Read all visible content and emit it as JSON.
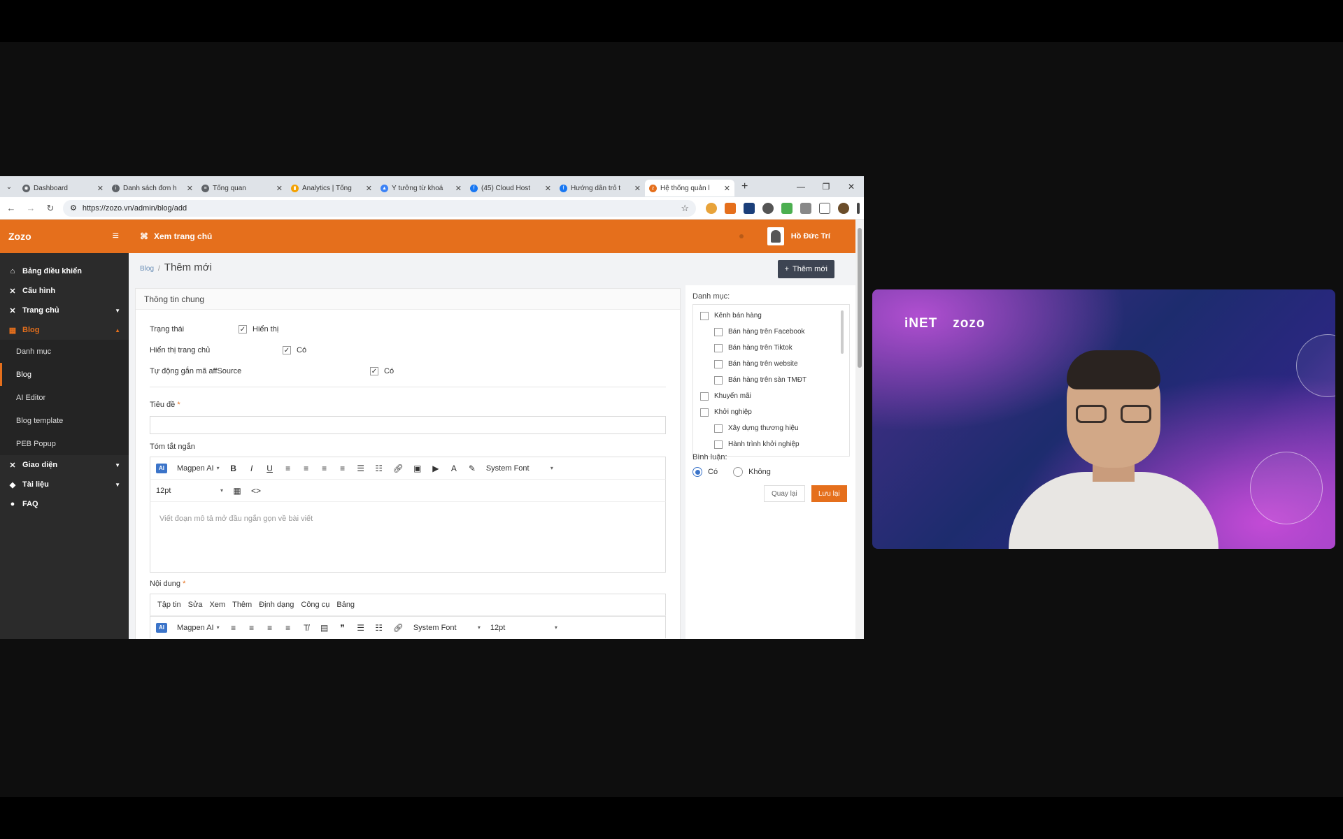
{
  "browser": {
    "tabs": [
      {
        "label": "Dashboard",
        "active": false
      },
      {
        "label": "Danh sách đơn h",
        "active": false
      },
      {
        "label": "Tổng quan",
        "active": false
      },
      {
        "label": "Analytics | Tổng",
        "active": false
      },
      {
        "label": "Ý tưởng từ khoá",
        "active": false
      },
      {
        "label": "(45) Cloud Host",
        "active": false
      },
      {
        "label": "Hướng dẫn trỏ t",
        "active": false
      },
      {
        "label": "Hệ thống quản l",
        "active": true
      }
    ],
    "url": "https://zozo.vn/admin/blog/add"
  },
  "app": {
    "logo": "Zozo",
    "top_nav_link": "Xem trang chủ",
    "user_name": "Hồ Đức Trí",
    "sidebar": {
      "items": [
        {
          "label": "Bảng điều khiển",
          "icon": "home-icon"
        },
        {
          "label": "Cấu hình",
          "icon": "tools-icon"
        },
        {
          "label": "Trang chủ",
          "icon": "tools-icon"
        },
        {
          "label": "Blog",
          "icon": "blog-icon"
        },
        {
          "label": "Giao diện",
          "icon": "tools-icon"
        },
        {
          "label": "Tài liệu",
          "icon": "tag-icon"
        },
        {
          "label": "FAQ",
          "icon": "user-icon"
        }
      ],
      "blog_subitems": [
        "Danh mục",
        "Blog",
        "AI Editor",
        "Blog template",
        "PEB Popup"
      ]
    },
    "breadcrumb": {
      "parent": "Blog",
      "separator": "/",
      "current": "Thêm mới"
    },
    "add_button": "Thêm mới",
    "panel_title": "Thông tin chung",
    "form": {
      "status_label": "Trạng thái",
      "status_value": "Hiển thị",
      "home_label": "Hiển thị trang chủ",
      "home_value": "Có",
      "aff_label": "Tự động gắn mã affSource",
      "aff_value": "Có",
      "title_label": "Tiêu đề",
      "title_value": "",
      "summary_label": "Tóm tắt ngắn",
      "summary_placeholder": "Viết đoạn mô tả mở đầu ngắn gọn về bài viết",
      "content_label": "Nội dung",
      "required_mark": "*"
    },
    "editor": {
      "ai_label": "AI",
      "magpen": "Magpen AI",
      "font": "System Font",
      "size": "12pt",
      "menu": [
        "Tập tin",
        "Sửa",
        "Xem",
        "Thêm",
        "Định dạng",
        "Công cụ",
        "Bảng"
      ]
    },
    "categories": {
      "label": "Danh mục:",
      "items": [
        {
          "label": "Kênh bán hàng",
          "level": 0
        },
        {
          "label": "Bán hàng trên Facebook",
          "level": 1
        },
        {
          "label": "Bán hàng trên Tiktok",
          "level": 1
        },
        {
          "label": "Bán hàng trên website",
          "level": 1
        },
        {
          "label": "Bán hàng trên sàn TMĐT",
          "level": 1
        },
        {
          "label": "Khuyến mãi",
          "level": 0
        },
        {
          "label": "Khởi nghiệp",
          "level": 0
        },
        {
          "label": "Xây dựng thương hiệu",
          "level": 1
        },
        {
          "label": "Hành trình khởi nghiệp",
          "level": 1
        }
      ]
    },
    "comments": {
      "label": "Bình luận:",
      "yes": "Có",
      "no": "Không",
      "selected": "yes"
    },
    "back_button": "Quay lại",
    "save_button": "Lưu lại",
    "accent_color": "#e56f1c"
  },
  "video": {
    "brand_left": "iNET",
    "brand_right": "zozo"
  }
}
